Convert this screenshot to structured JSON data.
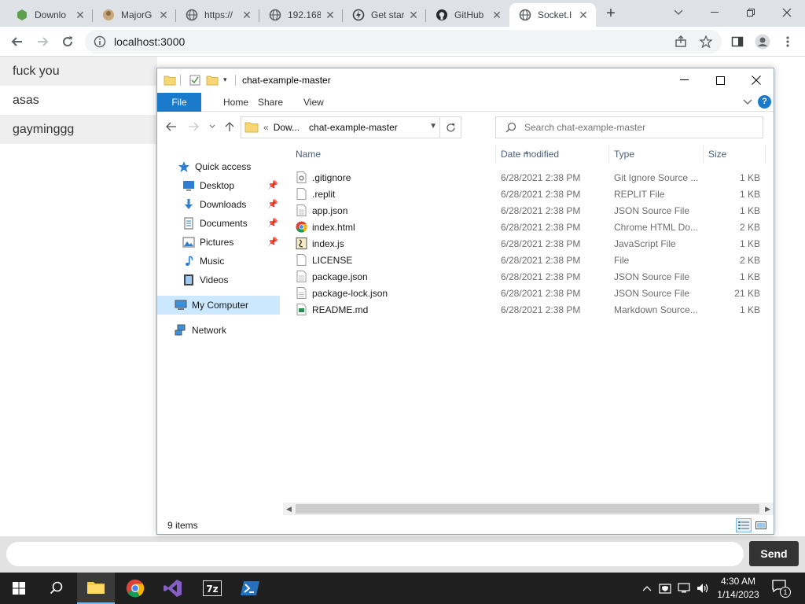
{
  "browser": {
    "tabs": [
      {
        "title": "Downlo",
        "icon": "nodejs-icon"
      },
      {
        "title": "MajorG",
        "icon": "avatar-icon"
      },
      {
        "title": "https://",
        "icon": "globe-icon"
      },
      {
        "title": "192.168",
        "icon": "globe-icon"
      },
      {
        "title": "Get star",
        "icon": "bolt-icon"
      },
      {
        "title": "GitHub",
        "icon": "github-icon"
      },
      {
        "title": "Socket.I",
        "icon": "globe-icon"
      }
    ],
    "active_tab": 6,
    "address": "localhost:3000"
  },
  "chat": {
    "messages": [
      "fuck you",
      "asas",
      "gayminggg"
    ],
    "input_value": "",
    "send_label": "Send"
  },
  "explorer": {
    "title": "chat-example-master",
    "ribbon_tabs": [
      "File",
      "Home",
      "Share",
      "View"
    ],
    "help_label": "?",
    "breadcrumb": [
      "Dow...",
      "chat-example-master"
    ],
    "breadcrumb_prefix": "«",
    "search_placeholder": "Search chat-example-master",
    "nav": {
      "quick_access": "Quick access",
      "items": [
        "Desktop",
        "Downloads",
        "Documents",
        "Pictures",
        "Music",
        "Videos"
      ],
      "my_computer": "My Computer",
      "network": "Network"
    },
    "columns": {
      "name": "Name",
      "date": "Date modified",
      "type": "Type",
      "size": "Size"
    },
    "files": [
      {
        "name": ".gitignore",
        "date": "6/28/2021 2:38 PM",
        "type": "Git Ignore Source ...",
        "size": "1 KB",
        "icon": "gear-file-icon"
      },
      {
        "name": ".replit",
        "date": "6/28/2021 2:38 PM",
        "type": "REPLIT File",
        "size": "1 KB",
        "icon": "blank-file-icon"
      },
      {
        "name": "app.json",
        "date": "6/28/2021 2:38 PM",
        "type": "JSON Source File",
        "size": "1 KB",
        "icon": "text-file-icon"
      },
      {
        "name": "index.html",
        "date": "6/28/2021 2:38 PM",
        "type": "Chrome HTML Do...",
        "size": "2 KB",
        "icon": "chrome-icon"
      },
      {
        "name": "index.js",
        "date": "6/28/2021 2:38 PM",
        "type": "JavaScript File",
        "size": "1 KB",
        "icon": "script-file-icon"
      },
      {
        "name": "LICENSE",
        "date": "6/28/2021 2:38 PM",
        "type": "File",
        "size": "2 KB",
        "icon": "blank-file-icon"
      },
      {
        "name": "package.json",
        "date": "6/28/2021 2:38 PM",
        "type": "JSON Source File",
        "size": "1 KB",
        "icon": "text-file-icon"
      },
      {
        "name": "package-lock.json",
        "date": "6/28/2021 2:38 PM",
        "type": "JSON Source File",
        "size": "21 KB",
        "icon": "text-file-icon"
      },
      {
        "name": "README.md",
        "date": "6/28/2021 2:38 PM",
        "type": "Markdown Source...",
        "size": "1 KB",
        "icon": "markdown-file-icon"
      }
    ],
    "status": "9 items"
  },
  "taskbar": {
    "time": "4:30 AM",
    "date": "1/14/2023",
    "notification_count": "1"
  },
  "colors": {
    "accent": "#1979ca",
    "selection": "#cce8ff",
    "taskbar": "#1f1f1f"
  }
}
